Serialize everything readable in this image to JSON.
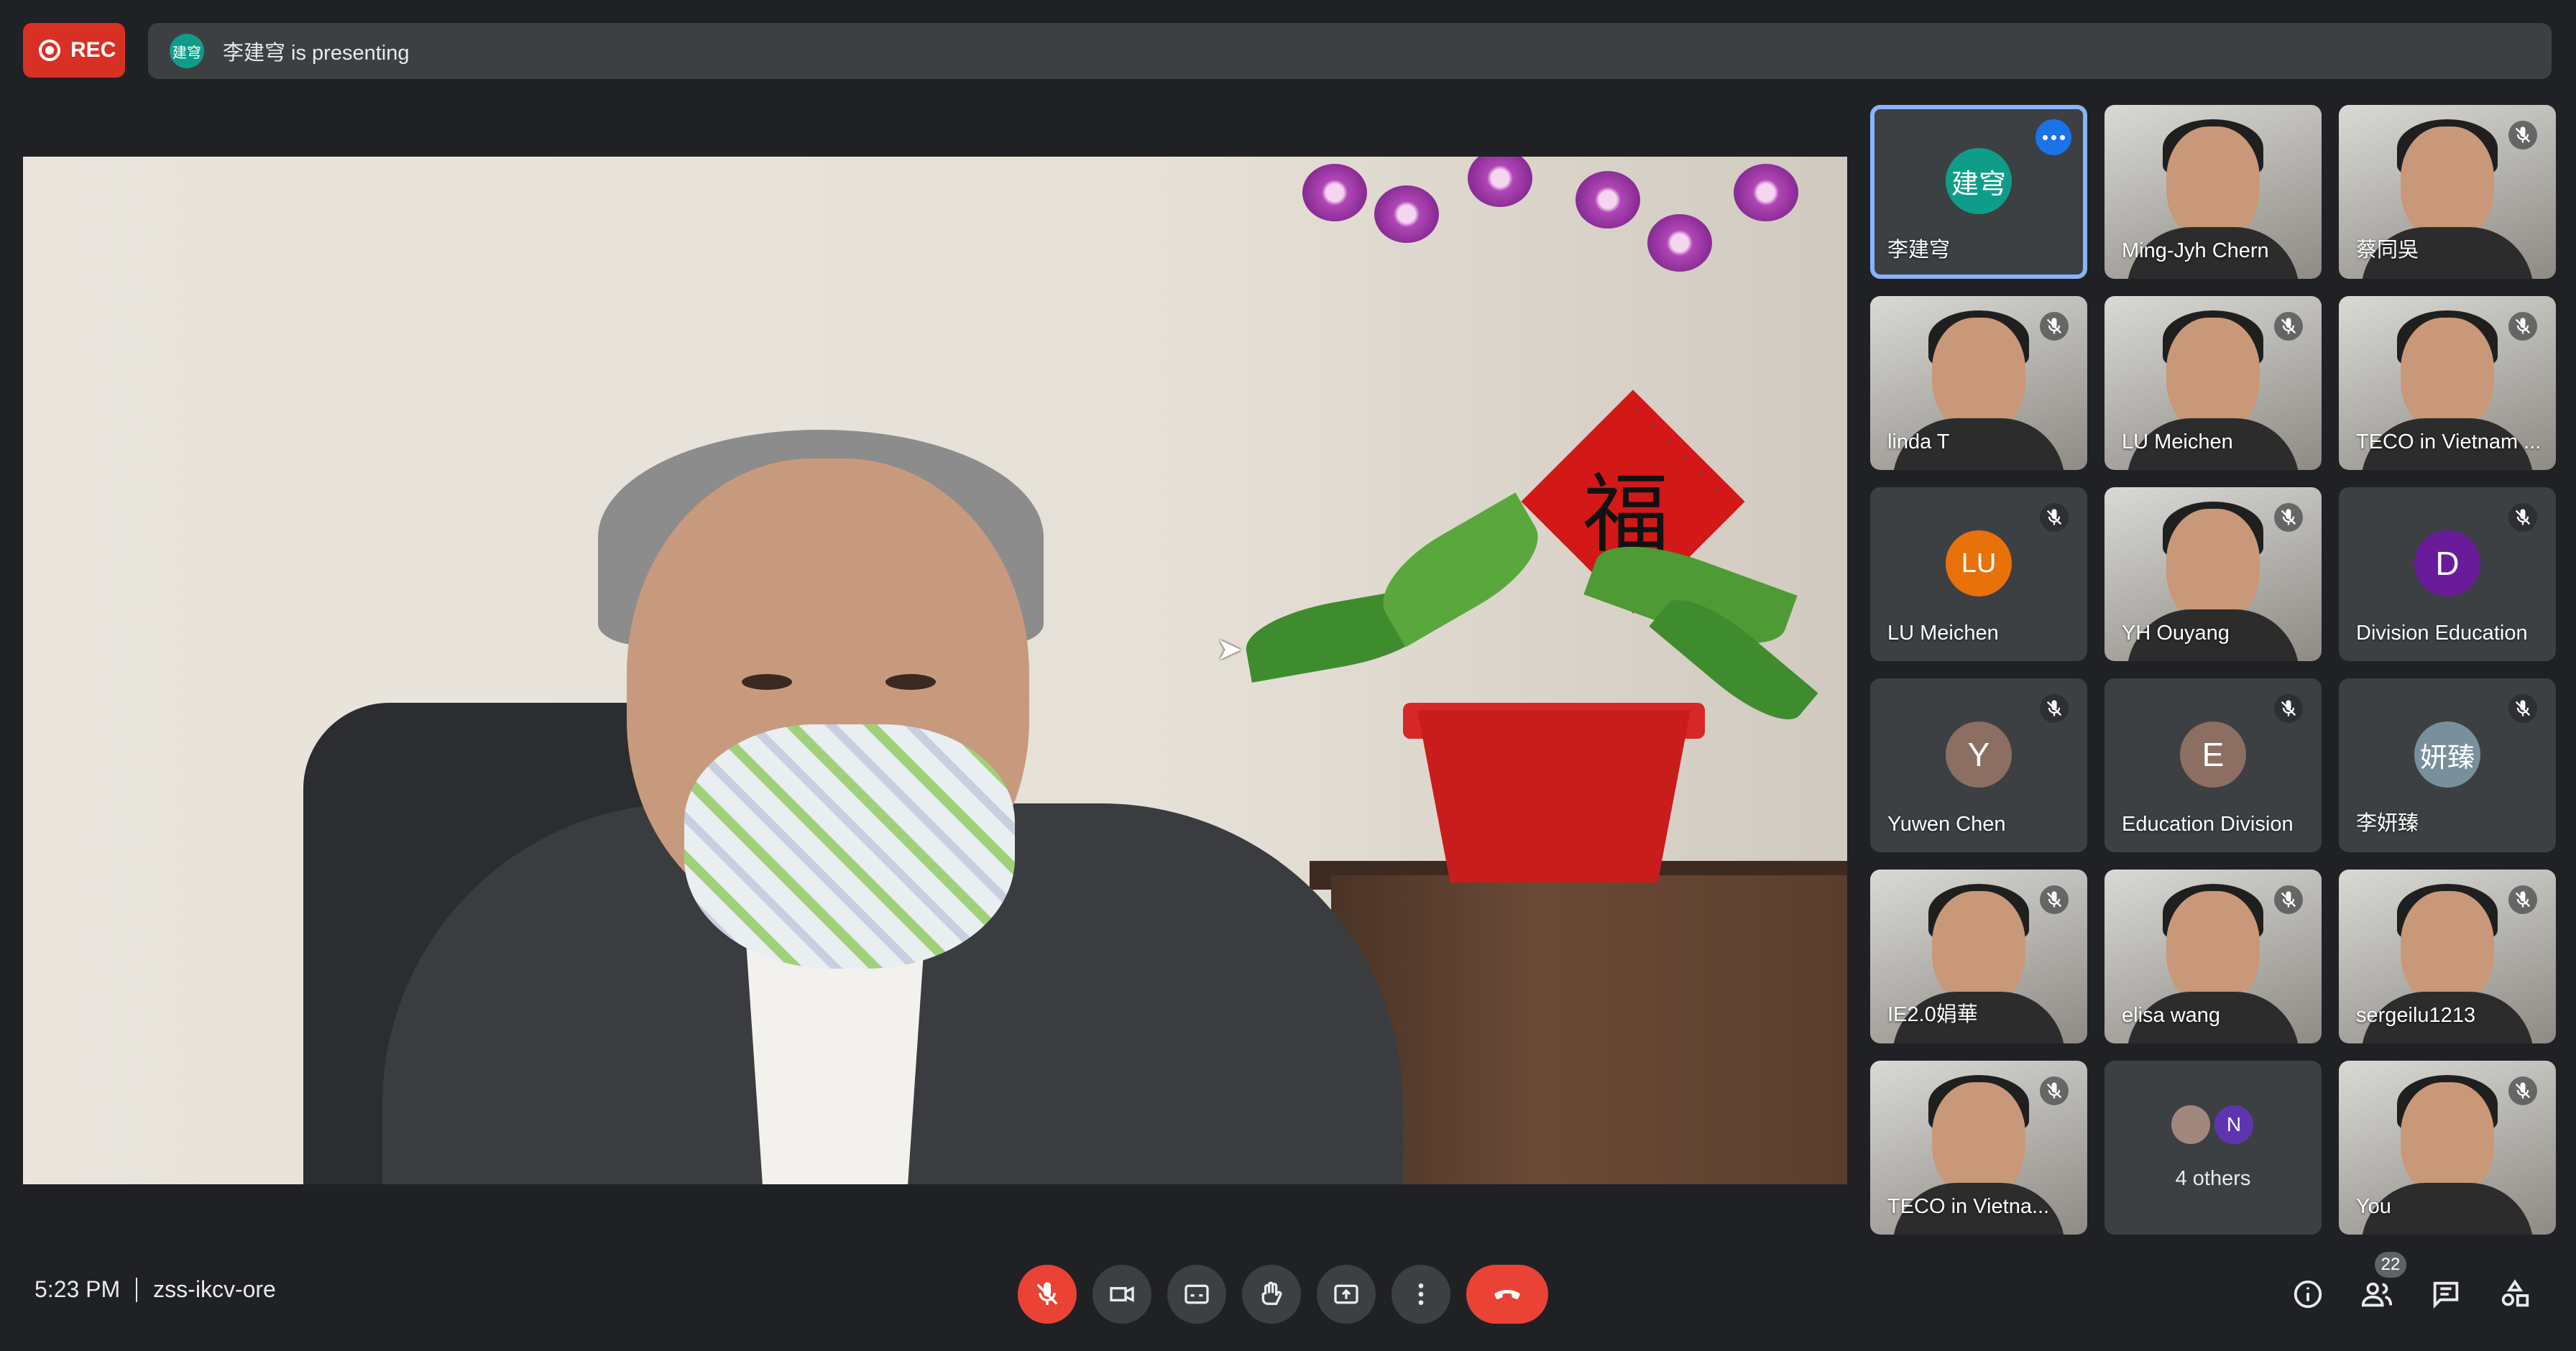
{
  "recording": {
    "label": "REC"
  },
  "presenter_bar": {
    "avatar_text": "建穹",
    "text": "李建穹 is presenting"
  },
  "participants": [
    {
      "name": "李建穹",
      "avatar": "建穹",
      "avatar_color": "#0f9d8a",
      "active": true
    },
    {
      "name": "Ming-Jyh Chern"
    },
    {
      "name": "蔡同吳"
    },
    {
      "name": "linda T"
    },
    {
      "name": "LU Meichen"
    },
    {
      "name": "TECO in Vietnam ..."
    },
    {
      "name": "LU Meichen",
      "avatar": "LU",
      "avatar_color": "#e8710a"
    },
    {
      "name": "YH Ouyang"
    },
    {
      "name": "Division Education",
      "avatar": "D",
      "avatar_color": "#6a1b9a"
    },
    {
      "name": "Yuwen Chen",
      "avatar": "Y",
      "avatar_color": "#8d6e63"
    },
    {
      "name": "Education Division",
      "avatar": "E",
      "avatar_color": "#8d6e63"
    },
    {
      "name": "李妍臻",
      "avatar": "妍臻",
      "avatar_color": "#78909c"
    },
    {
      "name": "IE2.0娟華"
    },
    {
      "name": "elisa wang"
    },
    {
      "name": "sergeilu1213"
    },
    {
      "name": "TECO in Vietna..."
    },
    {
      "name": "You"
    }
  ],
  "others_tile": {
    "avatar_letter": "N",
    "avatar_color": "#5e35b1",
    "label": "4 others"
  },
  "bottom_bar": {
    "time": "5:23 PM",
    "meeting_code": "zss-ikcv-ore",
    "participant_count": "22"
  },
  "main_video": {
    "sign_char": "福"
  }
}
